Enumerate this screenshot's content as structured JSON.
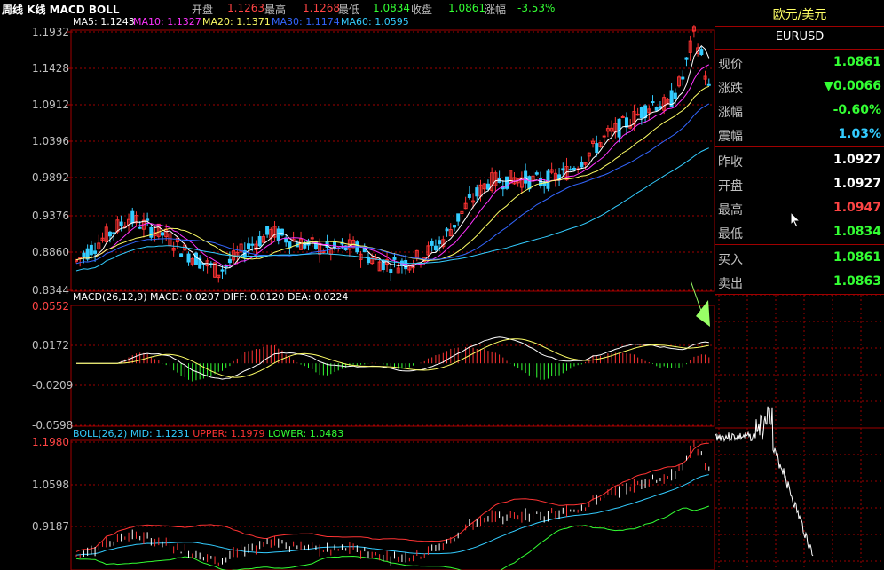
{
  "header": {
    "title": "周线 K线 MACD BOLL",
    "open_label": "开盘",
    "open_value": "1.1263",
    "high_label": "最高",
    "high_value": "1.1268",
    "low_label": "最低",
    "low_value": "1.0834",
    "close_label": "收盘",
    "close_value": "1.0861",
    "change_label": "涨幅",
    "change_value": "-3.53%"
  },
  "ma_legend": [
    {
      "label": "MA5: 1.1243",
      "color": "#ffffff"
    },
    {
      "label": "MA10: 1.1327",
      "color": "#ff33ff"
    },
    {
      "label": "MA20: 1.1371",
      "color": "#ffff66"
    },
    {
      "label": "MA30: 1.1174",
      "color": "#3366ff"
    },
    {
      "label": "MA60: 1.0595",
      "color": "#33ccff"
    }
  ],
  "price_axis": [
    "1.1932",
    "1.1428",
    "1.0912",
    "1.0396",
    "0.9892",
    "0.9376",
    "0.8860",
    "0.8344"
  ],
  "macd": {
    "legend": "MACD(26,12,9) MACD: 0.0207",
    "diff": "DIFF: 0.0120",
    "dea": "DEA: 0.0224",
    "axis": [
      "0.0552",
      "0.0172",
      "-0.0209",
      "-0.0598"
    ]
  },
  "boll": {
    "legend": "BOLL(26,2) MID: 1.1231",
    "upper": "UPPER: 1.1979",
    "lower": "LOWER: 1.0483",
    "axis": [
      "1.1980",
      "1.0598",
      "0.9187"
    ]
  },
  "quote_panel": {
    "name": "欧元/美元",
    "symbol": "EURUSD",
    "rows": [
      {
        "label": "现价",
        "value": "1.0861",
        "color": "#33ff33"
      },
      {
        "label": "涨跌",
        "value": "▼0.0066",
        "color": "#33ff33"
      },
      {
        "label": "涨幅",
        "value": "-0.60%",
        "color": "#33ff33"
      },
      {
        "label": "震幅",
        "value": "1.03%",
        "color": "#33ccff"
      },
      {
        "label": "昨收",
        "value": "1.0927",
        "color": "#ffffff"
      },
      {
        "label": "开盘",
        "value": "1.0927",
        "color": "#ffffff"
      },
      {
        "label": "最高",
        "value": "1.0947",
        "color": "#ff4444"
      },
      {
        "label": "最低",
        "value": "1.0834",
        "color": "#33ff33"
      },
      {
        "label": "买入",
        "value": "1.0861",
        "color": "#33ff33"
      },
      {
        "label": "卖出",
        "value": "1.0863",
        "color": "#33ff33"
      }
    ]
  },
  "colors": {
    "up": "#ff3333",
    "down": "#33ccff",
    "grid": "#a00000",
    "green": "#33ff33"
  }
}
